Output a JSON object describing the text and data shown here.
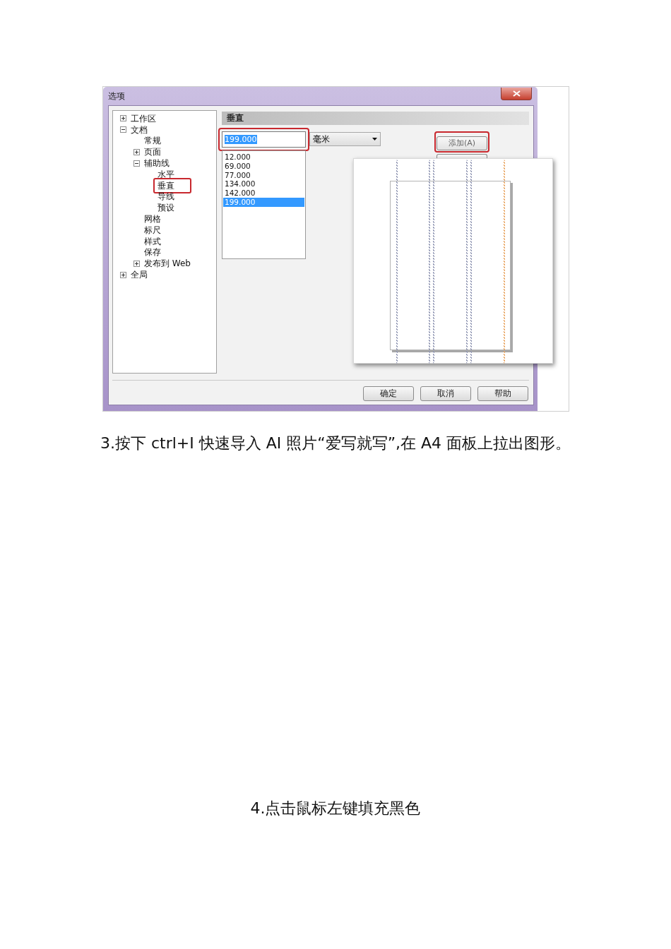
{
  "window": {
    "title": "选项"
  },
  "tree": [
    {
      "label": "工作区",
      "kind": "node",
      "expanded": false,
      "marked": false
    },
    {
      "label": "文档",
      "kind": "node",
      "expanded": true,
      "marked": false,
      "children": [
        {
          "label": "常规",
          "kind": "leaf",
          "marked": false
        },
        {
          "label": "页面",
          "kind": "node",
          "expanded": false,
          "marked": false
        },
        {
          "label": "辅助线",
          "kind": "node",
          "expanded": true,
          "marked": false,
          "children": [
            {
              "label": "水平",
              "kind": "leaf",
              "marked": false
            },
            {
              "label": "垂直",
              "kind": "leaf",
              "marked": true
            },
            {
              "label": "导线",
              "kind": "leaf",
              "marked": false
            },
            {
              "label": "预设",
              "kind": "leaf",
              "marked": false
            }
          ]
        },
        {
          "label": "网格",
          "kind": "leaf",
          "marked": false
        },
        {
          "label": "标尺",
          "kind": "leaf",
          "marked": false
        },
        {
          "label": "样式",
          "kind": "leaf",
          "marked": false
        },
        {
          "label": "保存",
          "kind": "leaf",
          "marked": false
        },
        {
          "label": "发布到 Web",
          "kind": "node",
          "expanded": false,
          "marked": false
        }
      ]
    },
    {
      "label": "全局",
      "kind": "node",
      "expanded": false,
      "marked": false
    }
  ],
  "panel": {
    "heading": "垂直",
    "value": {
      "text": "199.000",
      "highlighted": true,
      "marked": true
    },
    "unit": "毫米",
    "guides": [
      {
        "text": "12.000",
        "selected": false
      },
      {
        "text": "69.000",
        "selected": false
      },
      {
        "text": "77.000",
        "selected": false
      },
      {
        "text": "134.000",
        "selected": false
      },
      {
        "text": "142.000",
        "selected": false
      },
      {
        "text": "199.000",
        "selected": true
      }
    ],
    "side_buttons": [
      {
        "label": "添加(A)",
        "covered": false,
        "marked": true
      },
      {
        "covered": true,
        "marked": false
      }
    ]
  },
  "buttons": [
    {
      "label": "确定"
    },
    {
      "label": "取消"
    },
    {
      "label": "帮助"
    }
  ],
  "captions": [
    "3.按下 ctrl+I 快速导入 AI 照片“爱写就写”,在 A4 面板上拉出图形。",
    "4.点击鼠标左键填充黑色"
  ]
}
